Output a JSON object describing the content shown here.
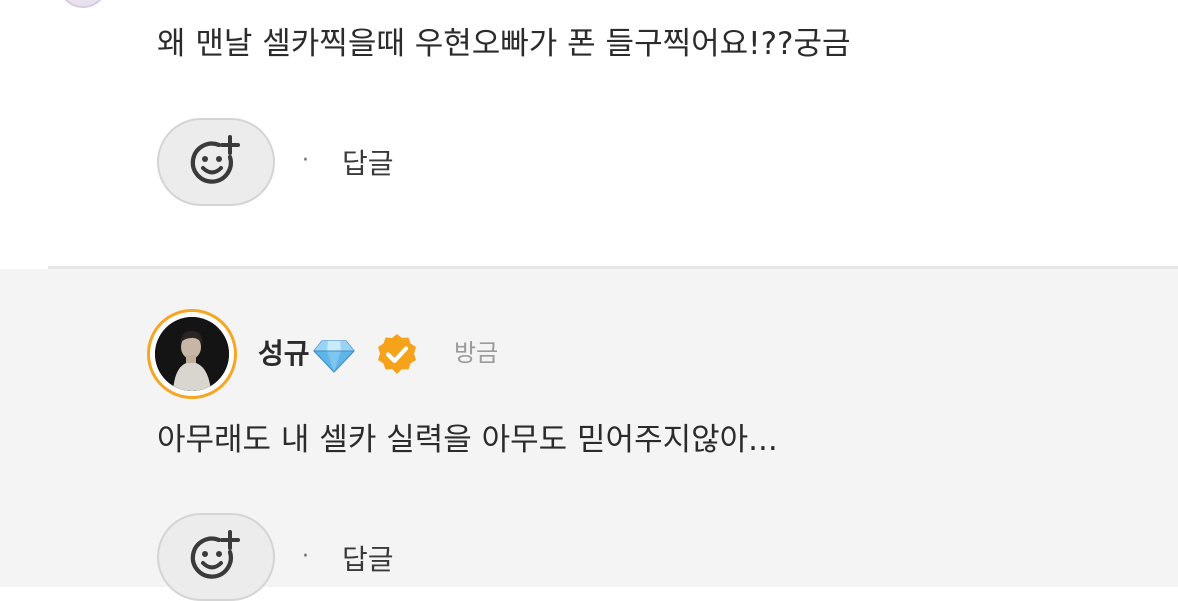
{
  "first_comment": {
    "text": "왜 맨날 셀카찍을때 우현오빠가 폰 들구찍어요!??궁금",
    "reaction_icon": "smiley-plus-icon",
    "separator": "·",
    "reply_label": "답글"
  },
  "reply": {
    "username": "성규",
    "badge_icon": "diamond-icon",
    "verified_icon": "verified-check-icon",
    "timestamp": "방금",
    "text": "아무래도 내 셀카 실력을 아무도 믿어주지않아...",
    "reaction_icon": "smiley-plus-icon",
    "separator": "·",
    "reply_label": "답글"
  },
  "colors": {
    "accent_ring": "#f5a623",
    "verified_badge": "#f7a21b",
    "gem": "#5fb4e8",
    "reply_background": "#f4f4f4"
  }
}
